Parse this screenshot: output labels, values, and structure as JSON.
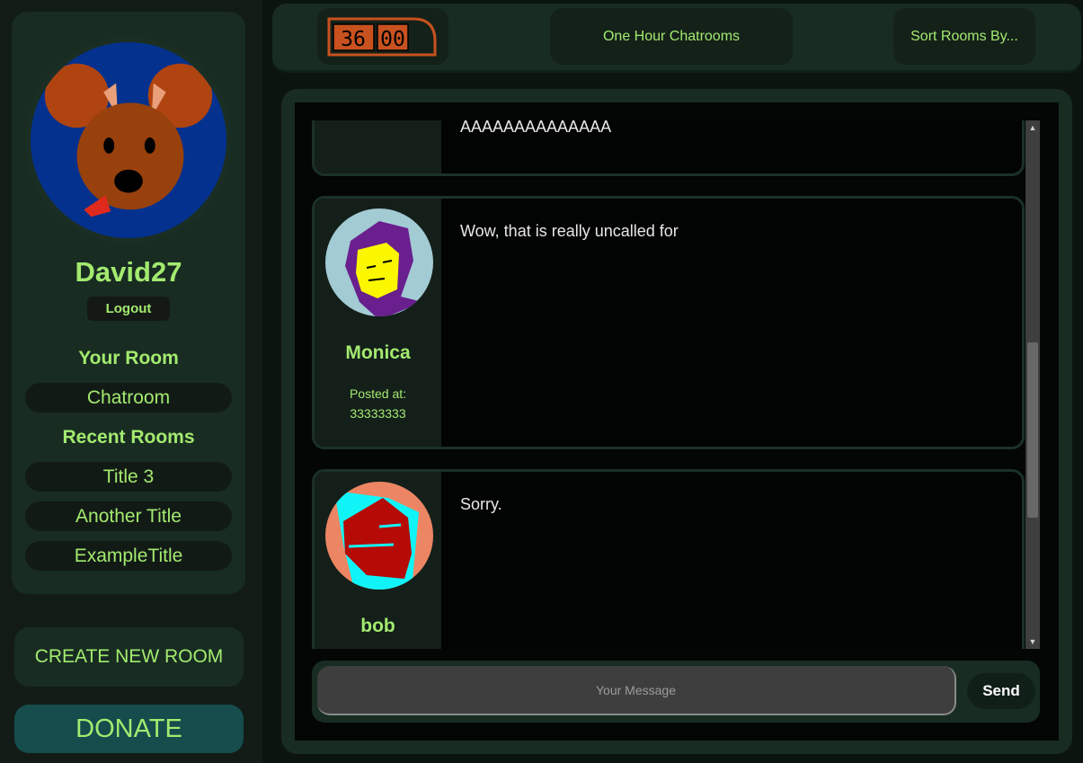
{
  "sidebar": {
    "username": "David27",
    "logout_label": "Logout",
    "your_room_heading": "Your Room",
    "your_room": "Chatroom",
    "recent_heading": "Recent Rooms",
    "recent_rooms": [
      "Title 3",
      "Another Title",
      "ExampleTitle"
    ],
    "create_label": "CREATE NEW ROOM",
    "donate_label": "DONATE",
    "avatar_icon": "dog-face-avatar"
  },
  "topbar": {
    "timer_digits": [
      "36",
      "00"
    ],
    "title": "One Hour Chatrooms",
    "sort_label": "Sort Rooms By..."
  },
  "messages": [
    {
      "user": "",
      "posted_label": "",
      "time": "",
      "text": "AAAAAAAAAAAAAAAAAAAAAAAAAAA AAAAAAAAAAAAAAA AAAAAAAAAAAAAAAAAAAAA"
    },
    {
      "user": "Monica",
      "posted_label": "Posted at:",
      "time": "33333333",
      "text": "Wow, that is really uncalled for",
      "avatar_icon": "purple-hair-face-avatar"
    },
    {
      "user": "bob",
      "posted_label": "",
      "time": "",
      "text": "Sorry.",
      "avatar_icon": "red-cyan-face-avatar"
    }
  ],
  "composer": {
    "placeholder": "Your Message",
    "send_label": "Send"
  },
  "colors": {
    "accent_green": "#a3ea6f",
    "panel": "#182c22",
    "donate": "#164c4c",
    "timer_orange": "#c8521f"
  }
}
